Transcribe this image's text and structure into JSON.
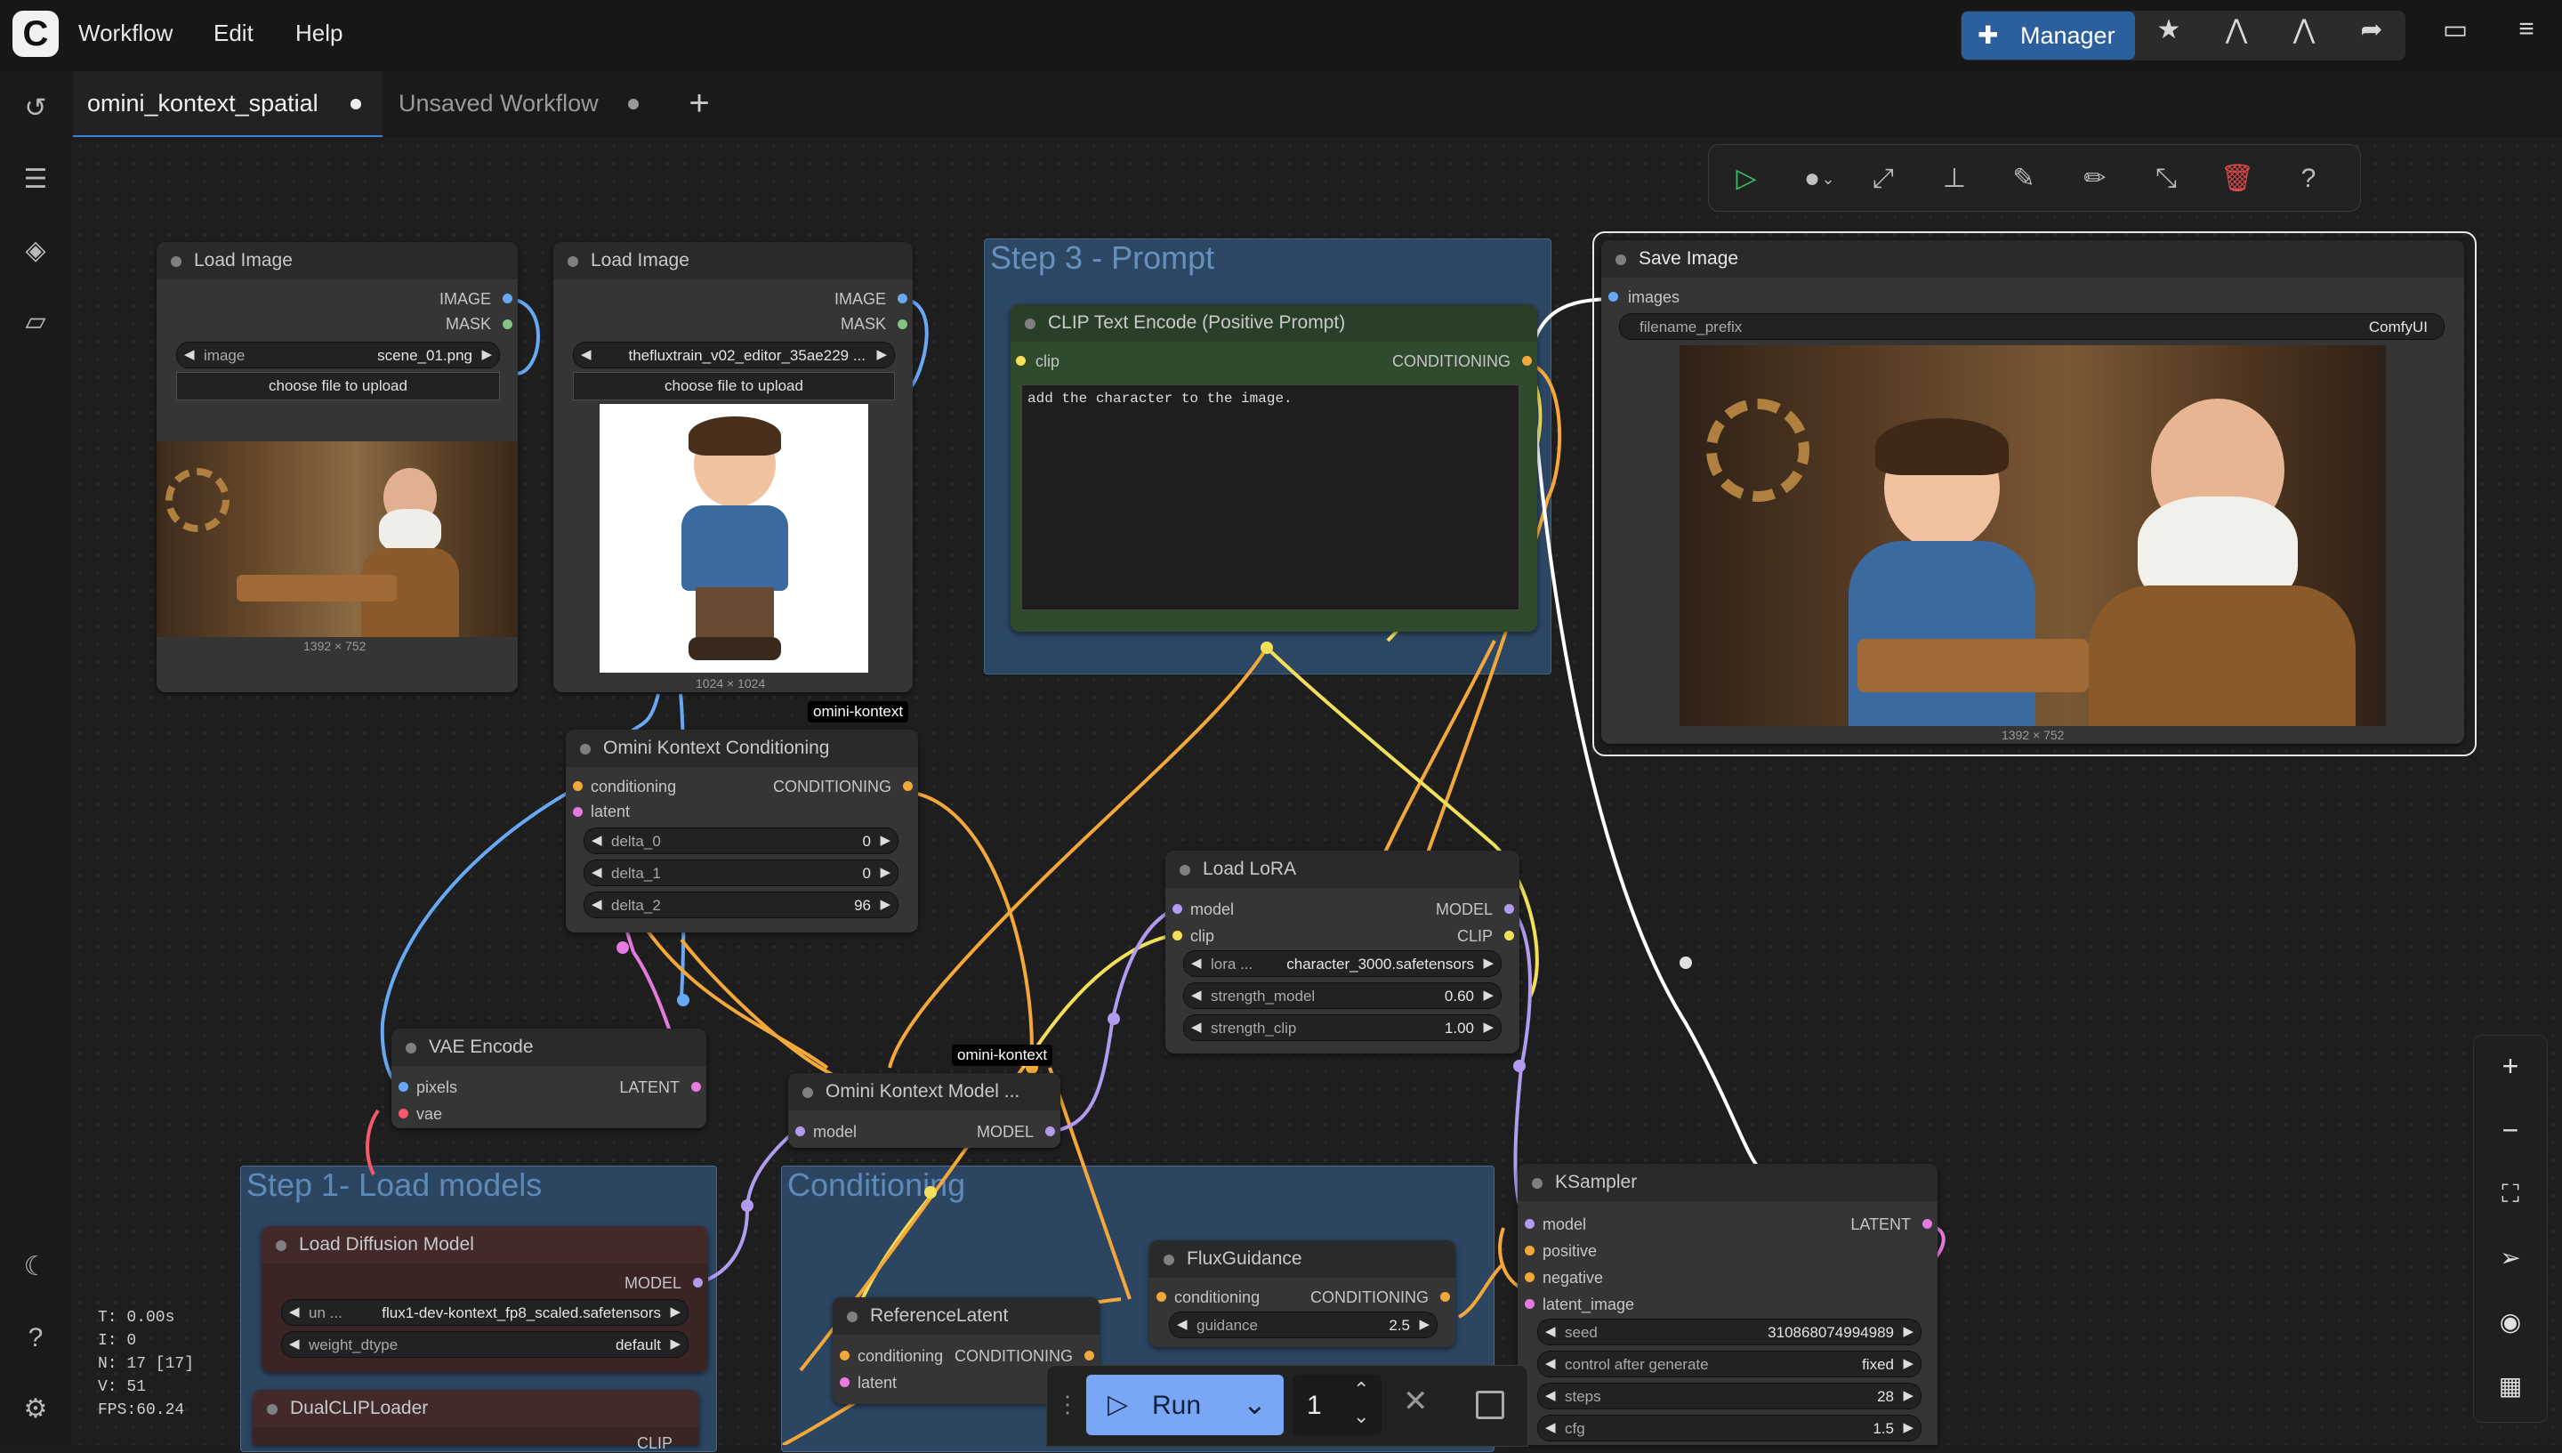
{
  "menu": {
    "workflow": "Workflow",
    "edit": "Edit",
    "help": "Help"
  },
  "topbar": {
    "manager_label": "Manager"
  },
  "tabs": [
    {
      "label": "omini_kontext_spatial"
    },
    {
      "label": "Unsaved Workflow"
    }
  ],
  "colors": {
    "accent": "#2b5f9e",
    "run_button": "#7aa7f5",
    "step3_group": "#2d4a68",
    "prompt_node": "#2f4a2c"
  },
  "groups": {
    "step3": "Step 3 - Prompt",
    "step1": "Step 1- Load models",
    "conditioning": "Conditioning"
  },
  "nodes": {
    "load_image_1": {
      "title": "Load Image",
      "out_image": "IMAGE",
      "out_mask": "MASK",
      "image_name": "image",
      "image_value": "scene_01.png",
      "upload": "choose file to upload",
      "size": "1392 × 752"
    },
    "load_image_2": {
      "title": "Load Image",
      "out_image": "IMAGE",
      "out_mask": "MASK",
      "image_value": "thefluxtrain_v02_editor_35ae229 ...",
      "upload": "choose file to upload",
      "size": "1024 × 1024"
    },
    "clip_text": {
      "title": "CLIP Text Encode (Positive Prompt)",
      "in_clip": "clip",
      "out": "CONDITIONING",
      "prompt": "add the character to the image."
    },
    "save_image": {
      "title": "Save Image",
      "in_images": "images",
      "prefix_name": "filename_prefix",
      "prefix_value": "ComfyUI",
      "size": "1392 × 752"
    },
    "omini_cond": {
      "title": "Omini Kontext Conditioning",
      "badge": "omini-kontext",
      "in_cond": "conditioning",
      "in_latent": "latent",
      "out": "CONDITIONING",
      "delta0_name": "delta_0",
      "delta0": "0",
      "delta1_name": "delta_1",
      "delta1": "0",
      "delta2_name": "delta_2",
      "delta2": "96"
    },
    "load_lora": {
      "title": "Load LoRA",
      "in_model": "model",
      "in_clip": "clip",
      "out_model": "MODEL",
      "out_clip": "CLIP",
      "lora_name": "lora ...",
      "lora_value": "character_3000.safetensors",
      "sm_name": "strength_model",
      "sm_value": "0.60",
      "sc_name": "strength_clip",
      "sc_value": "1.00"
    },
    "vae_encode": {
      "title": "VAE Encode",
      "in_pixels": "pixels",
      "in_vae": "vae",
      "out": "LATENT"
    },
    "omini_model": {
      "title": "Omini Kontext Model ...",
      "badge": "omini-kontext",
      "in_model": "model",
      "out": "MODEL"
    },
    "load_diffusion": {
      "title": "Load Diffusion Model",
      "out": "MODEL",
      "unet_name": "un ...",
      "unet_value": "flux1-dev-kontext_fp8_scaled.safetensors",
      "dtype_name": "weight_dtype",
      "dtype_value": "default"
    },
    "dual_clip": {
      "title": "DualCLIPLoader",
      "out": "CLIP"
    },
    "flux_guidance": {
      "title": "FluxGuidance",
      "in_cond": "conditioning",
      "out": "CONDITIONING",
      "guidance_name": "guidance",
      "guidance_value": "2.5"
    },
    "reference_latent": {
      "title": "ReferenceLatent",
      "in_cond": "conditioning",
      "in_latent": "latent",
      "out": "CONDITIONING"
    },
    "ksampler": {
      "title": "KSampler",
      "in_model": "model",
      "in_pos": "positive",
      "in_neg": "negative",
      "in_latent": "latent_image",
      "out": "LATENT",
      "seed_name": "seed",
      "seed_value": "310868074994989",
      "cag_name": "control after generate",
      "cag_value": "fixed",
      "steps_name": "steps",
      "steps_value": "28",
      "cfg_name": "cfg",
      "cfg_value": "1.5"
    }
  },
  "runbar": {
    "run_label": "Run",
    "count": "1"
  },
  "stats": {
    "t": "T: 0.00s",
    "i": "I: 0",
    "n": "N: 17 [17]",
    "v": "V: 51",
    "fps": "FPS:60.24"
  }
}
